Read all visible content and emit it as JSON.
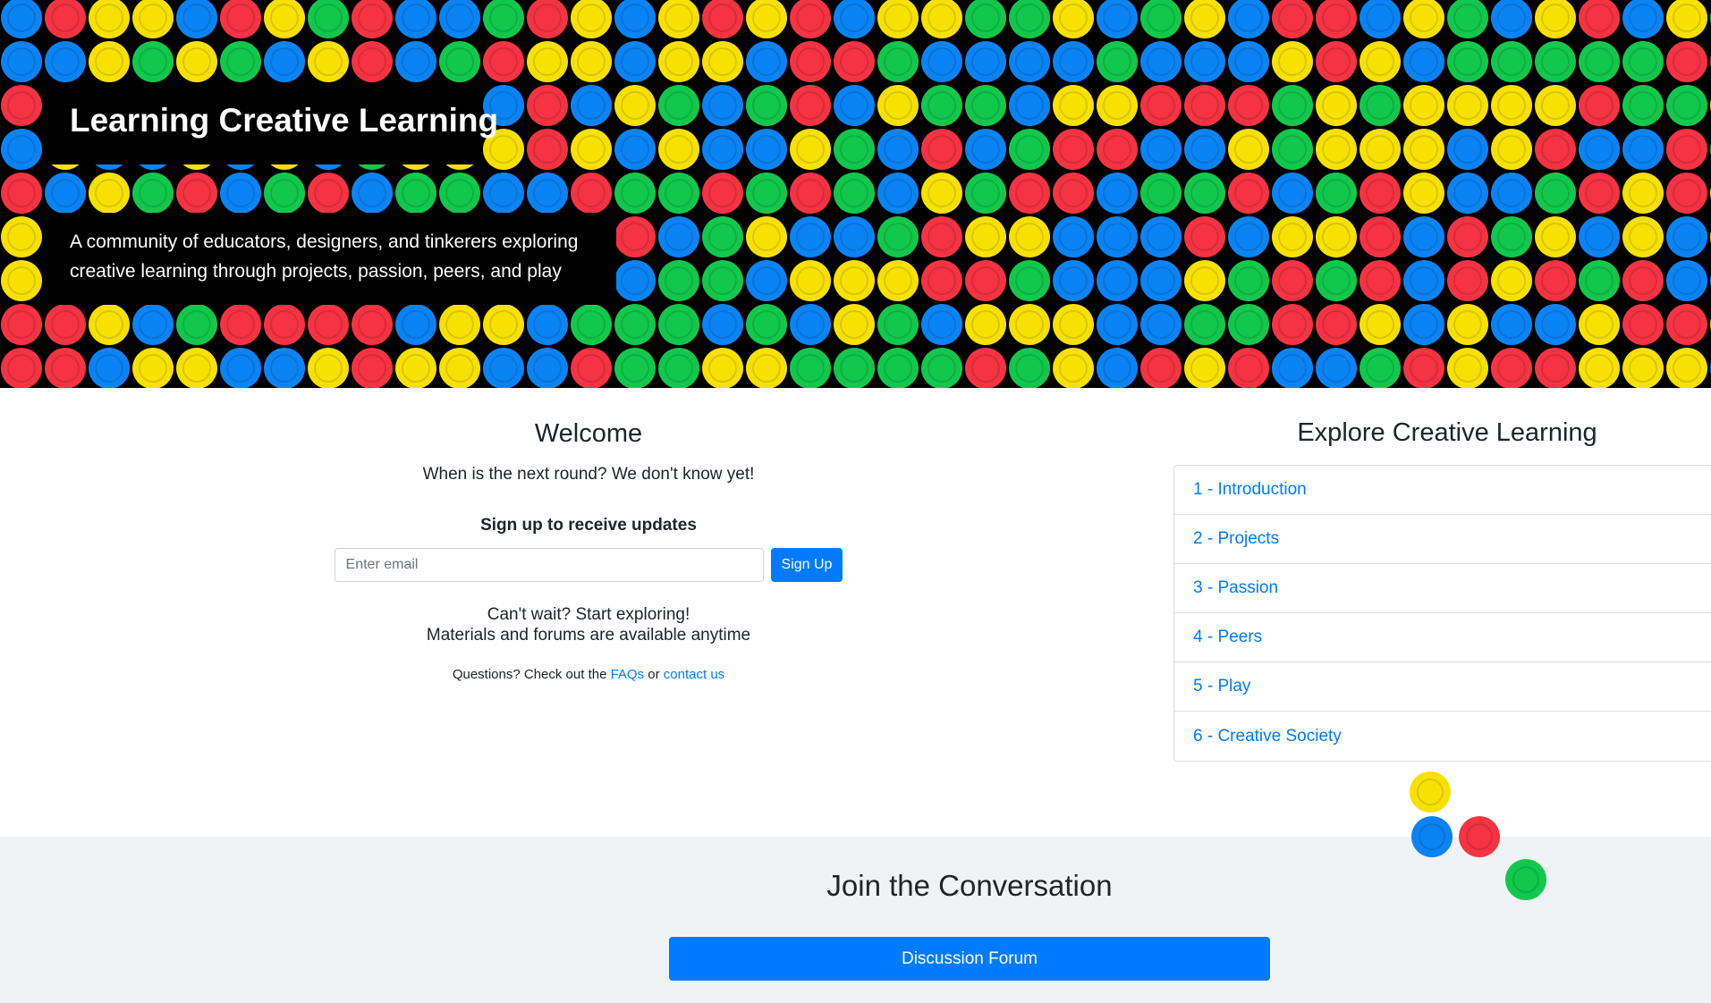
{
  "hero": {
    "title": "Learning Creative Learning",
    "subtitle": "A community of educators, designers, and tinkerers exploring creative learning through projects, passion, peers, and play",
    "dot_colors": {
      "yellow": "#f8e100",
      "blue": "#0a84f5",
      "red": "#f53343",
      "green": "#12c84c",
      "background": "#000000"
    }
  },
  "welcome": {
    "title": "Welcome",
    "note": "When is the next round? We don't know yet!",
    "signup_heading": "Sign up to receive updates",
    "email_placeholder": "Enter email",
    "signup_button": "Sign Up",
    "cantwait_line1": "Can't wait? Start exploring!",
    "cantwait_line2": "Materials and forums are available anytime",
    "questions_prefix": "Questions? Check out the",
    "faqs_link": "FAQs",
    "or_text": "or",
    "contact_link": "contact us"
  },
  "explore": {
    "title": "Explore Creative Learning",
    "items": [
      "1 - Introduction",
      "2 - Projects",
      "3 - Passion",
      "4 - Peers",
      "5 - Play",
      "6 - Creative Society"
    ]
  },
  "join": {
    "title": "Join the Conversation",
    "forum_button": "Discussion Forum"
  },
  "colors": {
    "accent": "#007bff",
    "join_background": "#f0f3f5"
  }
}
